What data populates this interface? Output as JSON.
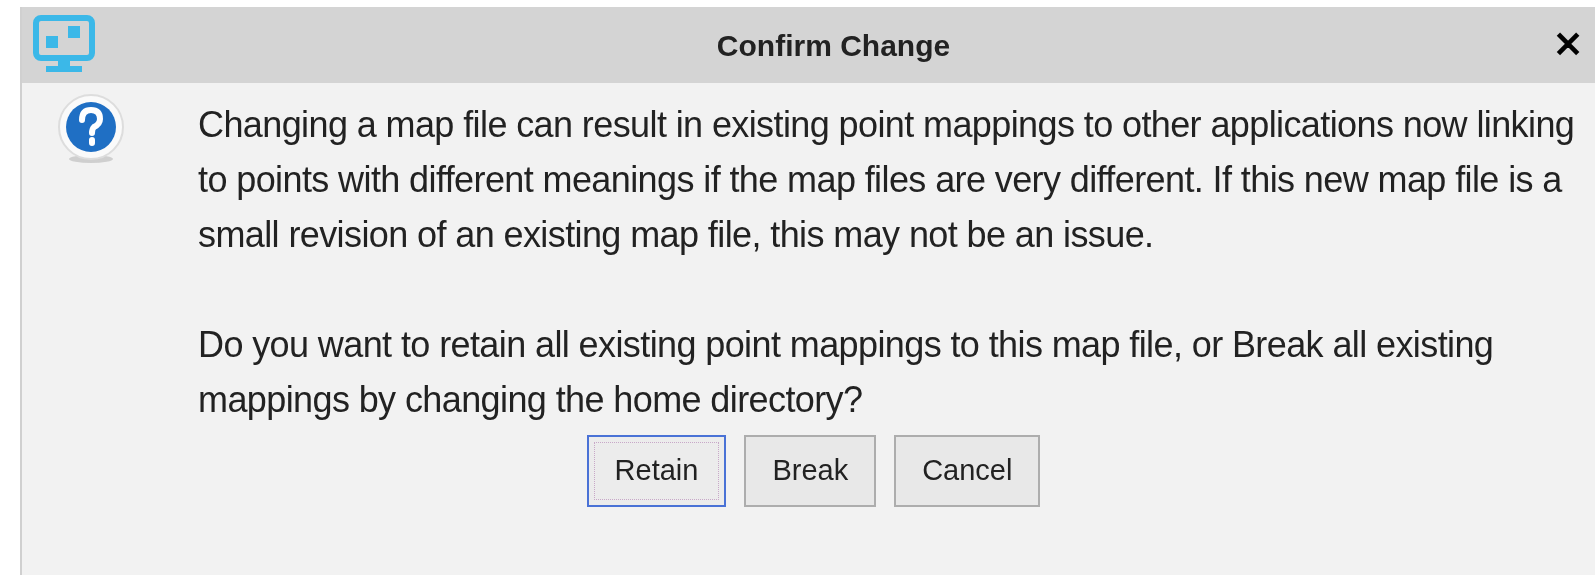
{
  "window": {
    "title": "Confirm Change",
    "close": "✕"
  },
  "message": {
    "paragraphs": [
      "Changing a map file can result in existing point mappings to other applications now linking to points with different meanings if the map files are very different. If this new map file is a small revision of an existing map file, this may not be an issue.",
      "Do you want to retain all existing point mappings to this map file, or Break all existing mappings by changing the home directory?"
    ]
  },
  "buttons": [
    {
      "label": "Retain",
      "selected": true
    },
    {
      "label": "Break",
      "selected": false
    },
    {
      "label": "Cancel",
      "selected": false
    }
  ]
}
